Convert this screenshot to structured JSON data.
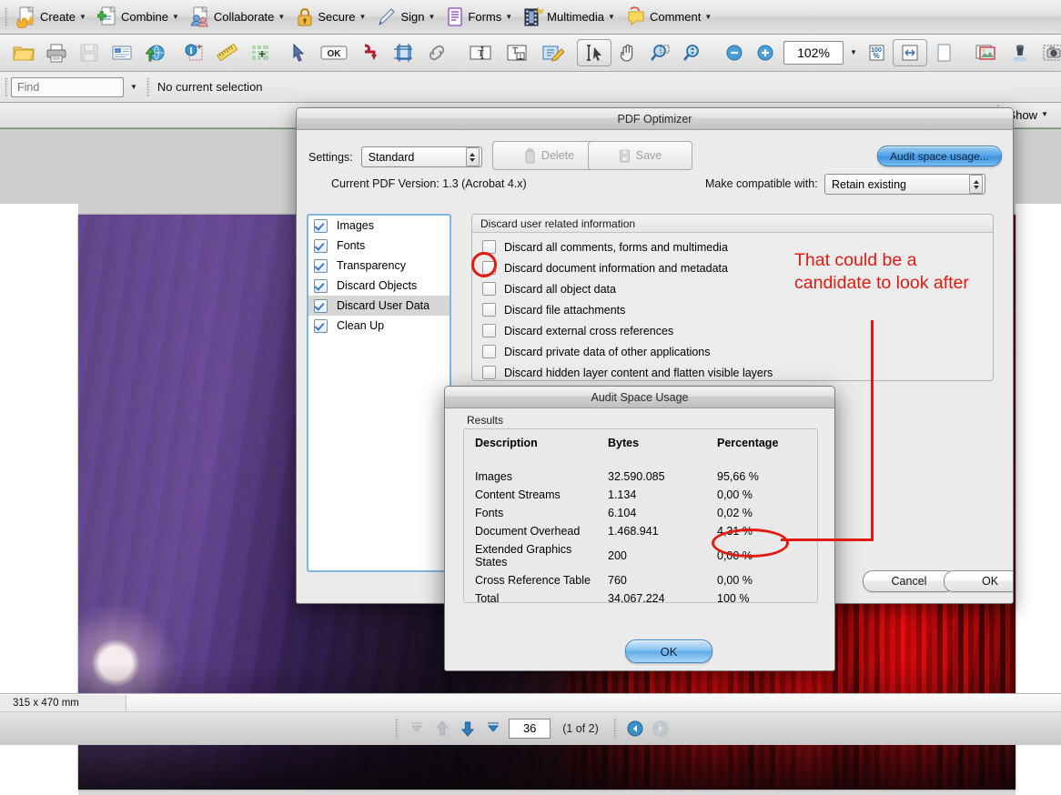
{
  "app": {
    "toolbar_main": [
      {
        "label": "Create",
        "icon": "create-doc-icon",
        "has_menu": true
      },
      {
        "label": "Combine",
        "icon": "combine-doc-icon",
        "has_menu": true
      },
      {
        "label": "Collaborate",
        "icon": "collaborate-icon",
        "has_menu": true
      },
      {
        "label": "Secure",
        "icon": "lock-icon",
        "has_menu": true
      },
      {
        "label": "Sign",
        "icon": "pen-icon",
        "has_menu": true
      },
      {
        "label": "Forms",
        "icon": "forms-icon",
        "has_menu": true
      },
      {
        "label": "Multimedia",
        "icon": "film-icon",
        "has_menu": true
      },
      {
        "label": "Comment",
        "icon": "speech-bubble-icon",
        "has_menu": true
      }
    ],
    "toolbar_secondary": {
      "zoom_value": "102%",
      "icons": [
        "open-folder-icon",
        "print-icon",
        "save-disk-icon",
        "email-icon",
        "upload-web-icon",
        "info-crop-icon",
        "ruler-icon",
        "measure-grid-icon",
        "select-arrow-icon",
        "ok-stamp-icon",
        "redact-icon",
        "crop-icon",
        "link-icon",
        "text-box-icon",
        "text-stamp-icon",
        "edit-text-icon",
        "select-tool-icon",
        "hand-tool-icon",
        "marquee-zoom-icon",
        "dynamic-zoom-icon",
        "zoom-out-icon",
        "zoom-in-icon",
        "actual-size-icon",
        "fit-width-icon",
        "single-page-icon",
        "image-panel-icon",
        "ink-icon",
        "snapshot-icon",
        "tei-icon"
      ]
    },
    "findbar": {
      "placeholder": "Find",
      "selection_status": "No current selection"
    },
    "show_menu": {
      "label": "Show"
    },
    "statusbar": {
      "page_size": "315 x 470 mm",
      "page_number_value": "36",
      "page_of_label": "(1 of 2)"
    }
  },
  "optimizer": {
    "title": "PDF Optimizer",
    "settings_label": "Settings:",
    "settings_value": "Standard",
    "delete_button": "Delete",
    "save_button": "Save",
    "audit_button": "Audit space usage...",
    "version_text": "Current PDF Version: 1.3 (Acrobat 4.x)",
    "compat_label": "Make compatible with:",
    "compat_value": "Retain existing",
    "categories": [
      {
        "label": "Images",
        "checked": true,
        "selected": false
      },
      {
        "label": "Fonts",
        "checked": true,
        "selected": false
      },
      {
        "label": "Transparency",
        "checked": true,
        "selected": false
      },
      {
        "label": "Discard Objects",
        "checked": true,
        "selected": false
      },
      {
        "label": "Discard User Data",
        "checked": true,
        "selected": true
      },
      {
        "label": "Clean Up",
        "checked": true,
        "selected": false
      }
    ],
    "group_title": "Discard user related information",
    "options": [
      {
        "label": "Discard all comments, forms and multimedia",
        "checked": false
      },
      {
        "label": "Discard document information and metadata",
        "checked": false
      },
      {
        "label": "Discard all object data",
        "checked": false
      },
      {
        "label": "Discard file attachments",
        "checked": false
      },
      {
        "label": "Discard external cross references",
        "checked": false
      },
      {
        "label": "Discard private data of other applications",
        "checked": false
      },
      {
        "label": "Discard hidden layer content and flatten visible layers",
        "checked": false
      }
    ],
    "cancel_button": "Cancel",
    "ok_button": "OK"
  },
  "audit": {
    "title": "Audit Space Usage",
    "results_label": "Results",
    "columns": [
      "Description",
      "Bytes",
      "Percentage"
    ],
    "rows": [
      {
        "description": "Images",
        "bytes": "32.590.085",
        "percentage": "95,66 %"
      },
      {
        "description": "Content Streams",
        "bytes": "1.134",
        "percentage": "0,00 %"
      },
      {
        "description": "Fonts",
        "bytes": "6.104",
        "percentage": "0,02 %"
      },
      {
        "description": "Document Overhead",
        "bytes": "1.468.941",
        "percentage": "4,31 %"
      },
      {
        "description": "Extended Graphics States",
        "bytes": "200",
        "percentage": "0,00 %"
      },
      {
        "description": "Cross Reference Table",
        "bytes": "760",
        "percentage": "0,00 %"
      },
      {
        "description": "Total",
        "bytes": "34.067.224",
        "percentage": "100 %"
      }
    ],
    "ok_button": "OK"
  },
  "annotations": {
    "note_text": "That could be a candidate to look after",
    "note_color": "#e01b10"
  }
}
